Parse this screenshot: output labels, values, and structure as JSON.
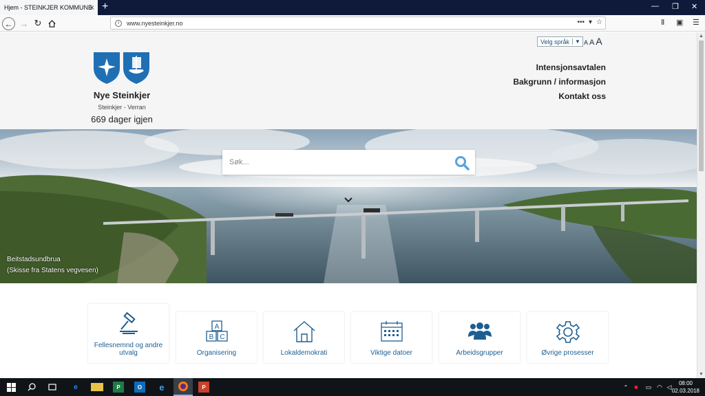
{
  "browser": {
    "tab_title": "Hjem - STEINKJER KOMMUNE",
    "tab_close": "×",
    "new_tab": "+",
    "url": "www.nyesteinkjer.no"
  },
  "header": {
    "site_name": "Nye Steinkjer",
    "subtitle": "Steinkjer - Verran",
    "countdown": "669 dager igjen",
    "language_select": "Velg språk",
    "font_sizes": [
      "A",
      "A",
      "A"
    ],
    "nav_links": [
      "Intensjonsavtalen",
      "Bakgrunn / informasjon",
      "Kontakt oss"
    ]
  },
  "hero": {
    "search_placeholder": "Søk...",
    "caption_line1": "Beitstadsundbrua",
    "caption_line2": "(Skisse fra Statens vegvesen)"
  },
  "cards": [
    {
      "icon": "gavel-icon",
      "label": "Fellesnemnd og andre utvalg"
    },
    {
      "icon": "abc-blocks-icon",
      "label": "Organisering"
    },
    {
      "icon": "house-icon",
      "label": "Lokaldemokrati"
    },
    {
      "icon": "calendar-icon",
      "label": "Viktige datoer"
    },
    {
      "icon": "people-icon",
      "label": "Arbeidsgrupper"
    },
    {
      "icon": "gear-icon",
      "label": "Øvrige prosesser"
    }
  ],
  "taskbar": {
    "time": "08:00",
    "date": "02.03.2018"
  },
  "colors": {
    "accent": "#1d5e92",
    "tabbar": "#0f1a3a",
    "taskbar": "#101418"
  }
}
